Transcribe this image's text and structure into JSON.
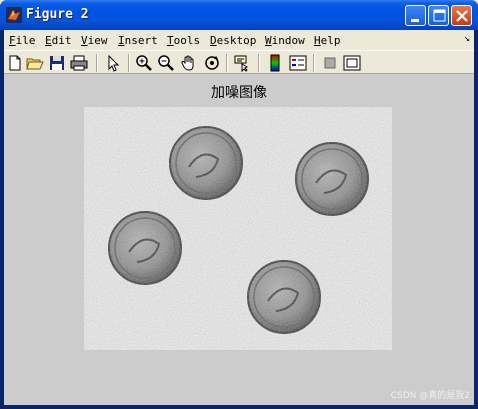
{
  "window": {
    "title": "Figure 2",
    "controls": [
      "minimize",
      "maximize",
      "close"
    ]
  },
  "menu": {
    "items": [
      {
        "label": "File",
        "hotkey": "F"
      },
      {
        "label": "Edit",
        "hotkey": "E"
      },
      {
        "label": "View",
        "hotkey": "V"
      },
      {
        "label": "Insert",
        "hotkey": "I"
      },
      {
        "label": "Tools",
        "hotkey": "T"
      },
      {
        "label": "Desktop",
        "hotkey": "D"
      },
      {
        "label": "Window",
        "hotkey": "W"
      },
      {
        "label": "Help",
        "hotkey": "H"
      }
    ],
    "overflow_icon": "dock-arrow-icon"
  },
  "toolbar": {
    "tools": [
      "new-figure-icon",
      "open-file-icon",
      "save-icon",
      "print-icon",
      "edit-plot-arrow-icon",
      "zoom-in-icon",
      "zoom-out-icon",
      "pan-hand-icon",
      "rotate-3d-icon",
      "data-cursor-icon",
      "colorbar-icon",
      "legend-icon",
      "hide-plot-tools-icon",
      "show-plot-tools-icon"
    ]
  },
  "figure": {
    "title": "加噪图像",
    "image_description_colors": {
      "background": "#efefef",
      "coin_dark": "#4a4a4a",
      "coin_light": "#a8a8a8"
    }
  },
  "watermark": "CSDN @真的是我2"
}
